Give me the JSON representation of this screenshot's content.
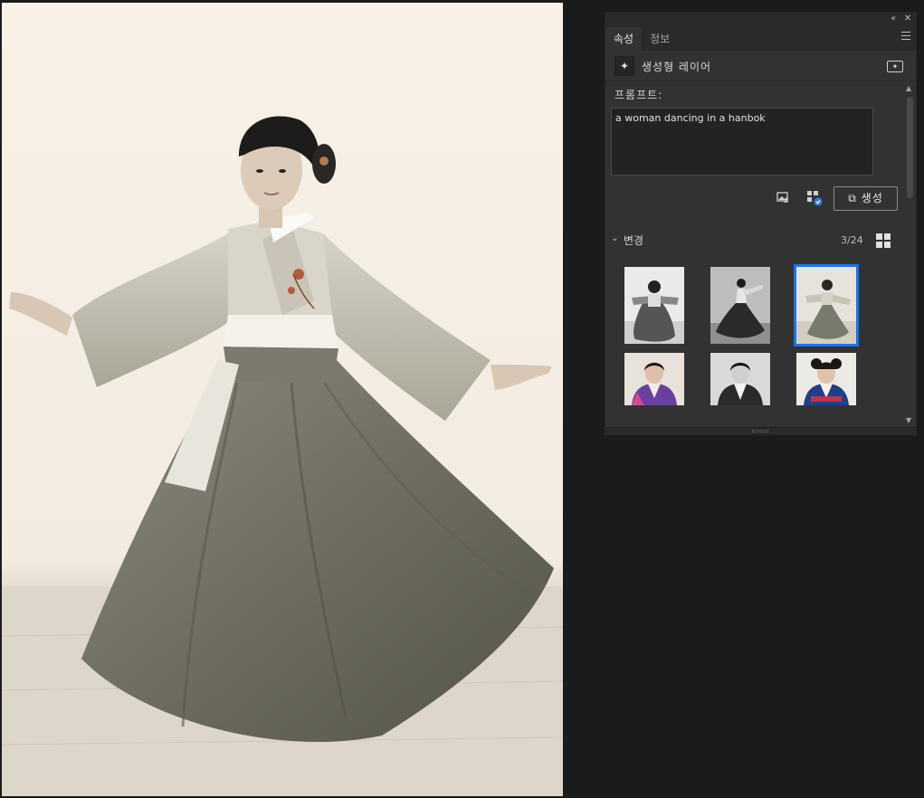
{
  "panel": {
    "collapse_icon": "double-chevron-left-icon",
    "close_icon": "close-icon",
    "tabs": [
      {
        "label": "속성",
        "active": true
      },
      {
        "label": "정보",
        "active": false
      }
    ],
    "menu_icon": "hamburger-icon"
  },
  "layer": {
    "icon": "generative-layer-icon",
    "title": "생성형 레이어",
    "action_icon": "generative-fill-icon"
  },
  "prompt": {
    "label": "프롬프트:",
    "value": "a woman dancing in a hanbok"
  },
  "actions": {
    "reference_image_icon": "reference-image-icon",
    "content_credentials_icon": "qr-check-icon",
    "generate_label": "생성",
    "generate_icon": "generate-icon"
  },
  "variations": {
    "label": "변경",
    "count": "3/24",
    "grid_icon": "grid-view-icon",
    "selected_index": 2
  },
  "colors": {
    "panel_bg": "#323232",
    "accent": "#1a73e8",
    "app_bg": "#1b1b1b"
  }
}
